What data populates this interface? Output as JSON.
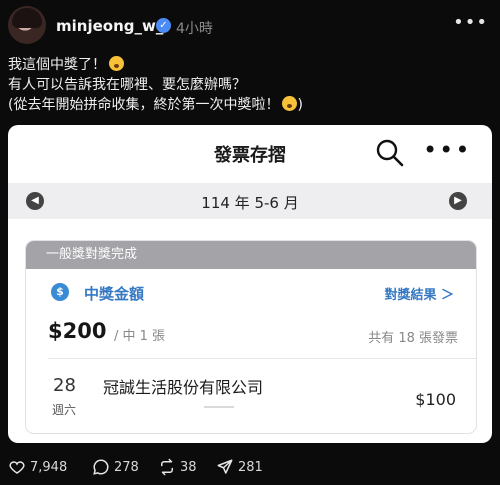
{
  "post": {
    "username": "minjeong_w_",
    "time": "4小時",
    "more": "•••",
    "caption": [
      "我這個中獎了！",
      "有人可以告訴我在哪裡、要怎麼辦嗎？",
      "(從去年開始拼命收集，終於第一次中獎啦！"
    ],
    "caption_end": ")"
  },
  "app": {
    "title": "發票存摺",
    "period": "114 年 5-6 月",
    "section_header": "一般獎對獎完成",
    "prize_label": "中獎金額",
    "check_link": "對獎結果 ＞",
    "amount": "$200",
    "count": "/ 中 1 張",
    "total": "共有 18 張發票",
    "row": {
      "day": "28",
      "weekday": "週六",
      "merchant": "冠誠生活股份有限公司",
      "amount": "$100"
    }
  },
  "actions": {
    "likes": "7,948",
    "comments": "278",
    "reposts": "38",
    "shares": "281"
  }
}
